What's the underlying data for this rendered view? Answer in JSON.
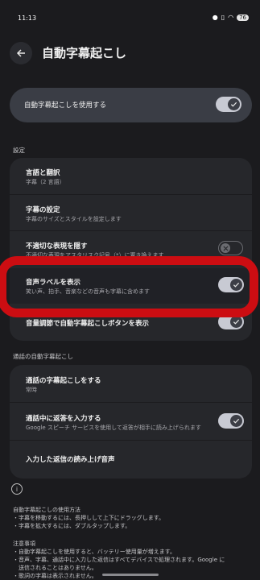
{
  "status_bar": {
    "time": "11:13",
    "battery": "76"
  },
  "header": {
    "title": "自動字幕起こし"
  },
  "master_toggle": {
    "label": "自動字幕起こしを使用する",
    "state": "on"
  },
  "settings_section": {
    "heading": "設定",
    "rows": [
      {
        "title": "言語と翻訳",
        "subtitle": "字幕（2 言語）"
      },
      {
        "title": "字幕の設定",
        "subtitle": "字幕のサイズとスタイルを設定します"
      },
      {
        "title": "不適切な表現を隠す",
        "subtitle": "不適切な表現をアスタリスク記号（*）に置き換えます",
        "toggle": "off"
      },
      {
        "title": "音声ラベルを表示",
        "subtitle": "笑い声、拍手、音楽などの音声も字幕に含めます",
        "toggle": "on"
      },
      {
        "title": "音量調節で自動字幕起こしボタンを表示",
        "toggle": "on"
      }
    ]
  },
  "call_section": {
    "heading": "通話の自動字幕起こし",
    "rows": [
      {
        "title": "通話の字幕起こしをする",
        "subtitle": "常時"
      },
      {
        "title": "通話中に返答を入力する",
        "subtitle": "Google スピーチ サービスを使用して返答が相手に読み上げられます",
        "toggle": "on"
      },
      {
        "title": "入力した返信の読み上げ音声"
      }
    ]
  },
  "footer": {
    "howto_title": "自動字幕起こしの使用方法",
    "howto_items": [
      "・字幕を移動するには、長押しして上下にドラッグします。",
      "・字幕を拡大するには、ダブルタップします。"
    ],
    "notes_title": "注意事項",
    "notes_items": [
      "・自動字幕起こしを使用すると、バッテリー使用量が増えます。",
      "・音声、字幕、通話中に入力した返信はすべてデバイスで処理されます。Google に",
      "送信されることはありません。",
      "・歌詞の字幕は表示されません。"
    ]
  },
  "colors": {
    "background": "#1b1b1e",
    "card": "#26272b",
    "highlight": "#cc0d12",
    "toggle_on": "#c8cad3"
  }
}
